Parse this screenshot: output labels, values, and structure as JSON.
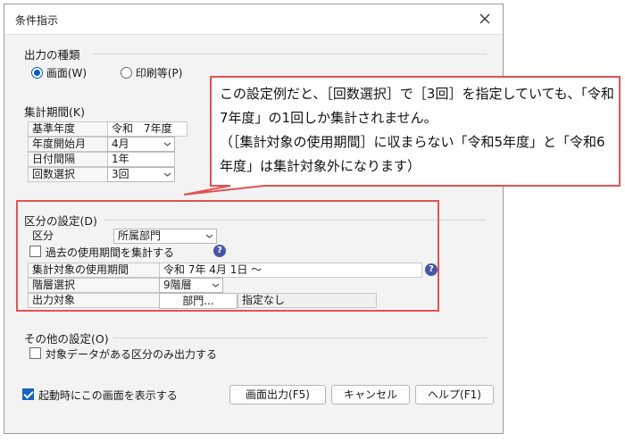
{
  "window": {
    "title": "条件指示"
  },
  "output_type": {
    "heading": "出力の種類",
    "screen_label": "画面(W)",
    "print_label": "印刷等(P)",
    "selected": "screen"
  },
  "period": {
    "heading": "集計期間(K)",
    "rows": [
      {
        "label": "基準年度",
        "value": "令和　7年度"
      },
      {
        "label": "年度開始月",
        "value": "4月"
      },
      {
        "label": "日付間隔",
        "value": "1年"
      },
      {
        "label": "回数選択",
        "value": "3回"
      }
    ]
  },
  "division": {
    "heading": "区分の設定(D)",
    "kubun_label": "区分",
    "kubun_value": "所属部門",
    "past_checkbox_label": "過去の使用期間を集計する",
    "period_label": "集計対象の使用期間",
    "period_value": "令和 7年 4月 1日 ～",
    "floor_label": "階層選択",
    "floor_value": "9階層",
    "target_label": "出力対象",
    "target_button": "部門...",
    "target_value": "指定なし"
  },
  "other": {
    "heading": "その他の設定(O)",
    "only_with_data_label": "対象データがある区分のみ出力する"
  },
  "footer": {
    "startup_label": "起動時にこの画面を表示する",
    "screen_output_button": "画面出力(F5)",
    "cancel_button": "キャンセル",
    "help_button": "ヘルプ(F1)"
  },
  "callout": {
    "text": "この設定例だと、［回数選択］で［3回］を指定していても、「令和7年度」の1回しか集計されません。\n（［集計対象の使用期間］に収まらない「令和5年度」と「令和6年度」は集計対象外になります）"
  },
  "colors": {
    "accent": "#1565c0",
    "highlight": "#e35252",
    "help": "#4755a7"
  },
  "icons": [
    "close-icon",
    "chevron-down-icon",
    "help-icon",
    "check-icon"
  ]
}
